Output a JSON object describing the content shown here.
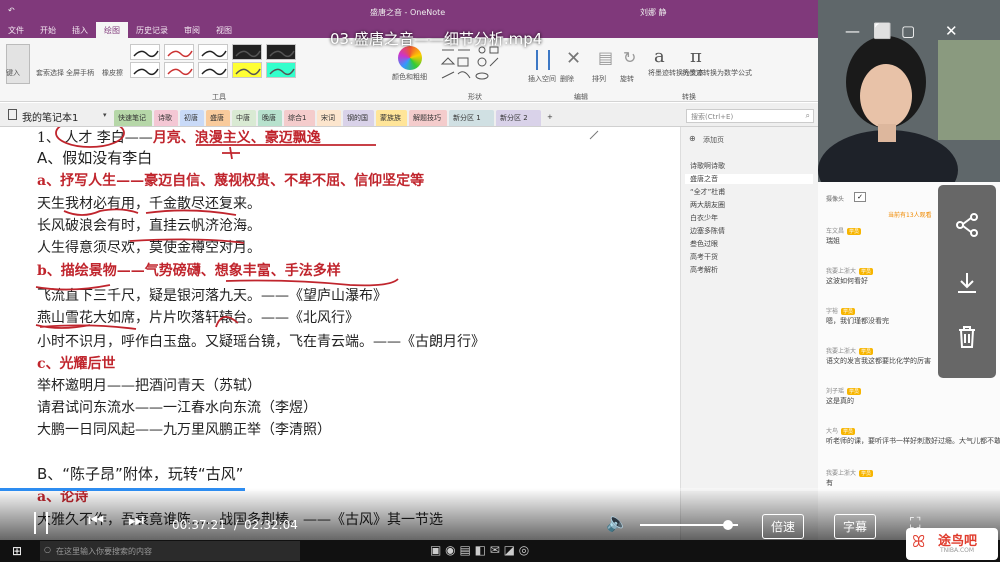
{
  "app": {
    "window_title": "盛唐之音 - OneNote",
    "user": "刘娜 静"
  },
  "menu": [
    "文件",
    "开始",
    "插入",
    "绘图",
    "历史记录",
    "审阅",
    "视图"
  ],
  "menu_active": "绘图",
  "ribbon": {
    "groups": [
      "工具",
      "形状",
      "编辑",
      "转换"
    ],
    "buttons": [
      "键入",
      "套索选择",
      "全屏手柄",
      "橡皮擦",
      "颜色和粗细",
      "插入空间",
      "删除",
      "排列",
      "旋转",
      "将墨迹转换为文本",
      "将墨迹转换为数学公式"
    ]
  },
  "notebook": {
    "name": "我的笔记本1",
    "tabs": [
      "快速笔记",
      "诗歌",
      "初唐",
      "盛唐",
      "中唐",
      "晚唐",
      "综合1",
      "宋词",
      "钢的国",
      "蒙族族",
      "解题技巧",
      "新分区 1",
      "新分区 2",
      "+"
    ],
    "search_placeholder": "搜索(Ctrl+E)"
  },
  "note_lines": [
    {
      "text": "1、 人才  李白——",
      "hl": "月亮、浪漫主义、豪迈飘逸"
    },
    {
      "text": "A、假如没有李白"
    },
    {
      "text": "a、抒写人生——豪迈自信、蔑视权贵、不卑不屈、信仰坚定等",
      "red": true
    },
    {
      "text": "天生我材必有用，千金散尽还复来。"
    },
    {
      "text": "长风破浪会有时，直挂云帆济沧海。"
    },
    {
      "text": "人生得意须尽欢，莫使金樽空对月。"
    },
    {
      "text": "b、描绘景物——气势磅礴、想象丰富、手法多样",
      "red": true
    },
    {
      "text": "飞流直下三千尺，疑是银河落九天。——《望庐山瀑布》"
    },
    {
      "text": "燕山雪花大如席，片片吹落轩辕台。——《北风行》"
    },
    {
      "text": "小时不识月，呼作白玉盘。又疑瑶台镜，飞在青云端。——《古朗月行》"
    },
    {
      "text": "c、光耀后世",
      "red": true
    },
    {
      "text": "举杯邀明月——把酒问青天（苏轼）"
    },
    {
      "text": "请君试问东流水——一江春水向东流（李煜）"
    },
    {
      "text": "大鹏一日同风起——九万里风鹏正举（李清照）"
    },
    {
      "text": "B、“陈子昂”附体，玩转“古风”"
    },
    {
      "text": "a、论诗",
      "red": true
    },
    {
      "text": "大雅久不作，吾衰竟谁陈……战国多荆榛。——《古风》其一节选"
    }
  ],
  "page_list": {
    "add_page": "添加页",
    "items": [
      "诗歌啊诗歌",
      "盛唐之音",
      "“全才”杜甫",
      "两大朋友圈",
      "白衣少年",
      "边塞多陈倩",
      "叁色过眼",
      "高考干货",
      "高考解析"
    ]
  },
  "video": {
    "title": "03.盛唐之音——细节分析.mp4",
    "current": "00:37:21",
    "total": "02:32:04",
    "progress": 0.245,
    "volume": 0.9,
    "speed_label": "倍速",
    "subtitle_label": "字幕"
  },
  "chat": {
    "camera_label": "摄像头",
    "viewers": "当前有13人观看",
    "messages": [
      {
        "name": "车文昌",
        "text": "瑞姐"
      },
      {
        "name": "我要上浙大",
        "text": "这波如何看好"
      },
      {
        "name": "字裕",
        "text": "嗯，我们瑾都没看完"
      },
      {
        "name": "我要上浙大",
        "text": "语文的发言我这都要比化学的厉害"
      },
      {
        "name": "刘子瑶",
        "text": "这是真的"
      },
      {
        "name": "大鸟",
        "text": "听老师的课，要听评书一样好刺激好过瘾。大气儿都不敢喘一个。"
      },
      {
        "name": "我要上浙大",
        "text": "有"
      }
    ]
  },
  "taskbar": {
    "search_placeholder": "在这里输入你要搜索的内容"
  },
  "watermark": {
    "text": "途鸟吧",
    "url": "TNIBA.COM"
  }
}
